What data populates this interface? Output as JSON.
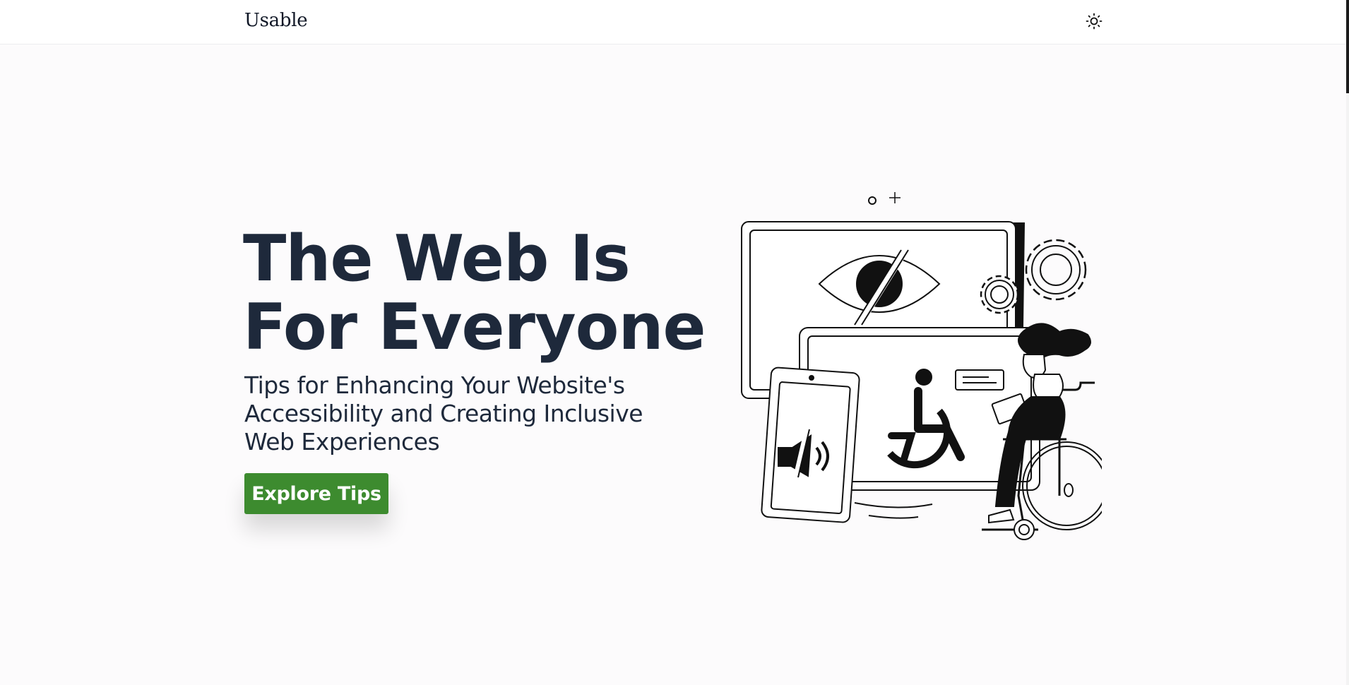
{
  "header": {
    "brand": "Usable",
    "theme_toggle_icon": "sun-icon"
  },
  "hero": {
    "title_line1": "The Web Is",
    "title_line2": "For Everyone",
    "subtitle_line1": "Tips for Enhancing Your Website's",
    "subtitle_line2": "Accessibility and Creating Inclusive",
    "subtitle_line3": "Web Experiences",
    "cta_label": "Explore Tips",
    "illustration_icon": "accessibility-illustration"
  },
  "colors": {
    "accent": "#3d8b2f",
    "heading": "#1e293b",
    "background": "#fcfbfc"
  }
}
